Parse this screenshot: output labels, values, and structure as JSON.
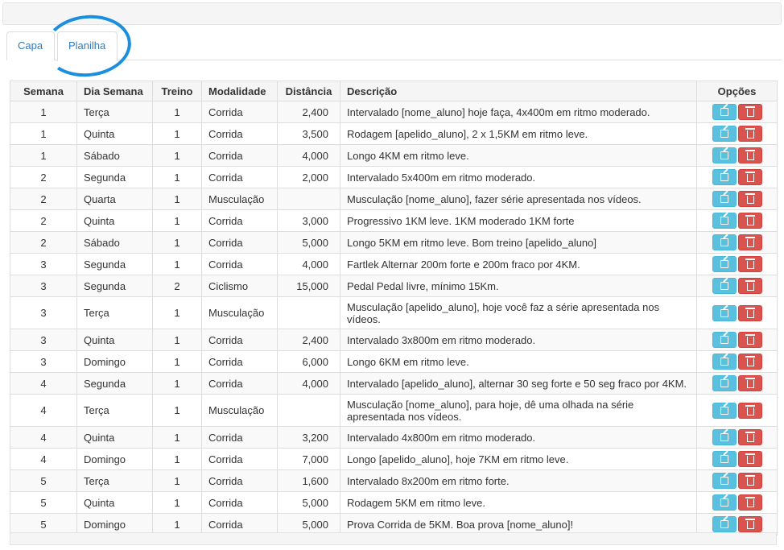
{
  "tabs": [
    {
      "label": "Capa"
    },
    {
      "label": "Planilha"
    }
  ],
  "table": {
    "headers": {
      "semana": "Semana",
      "dia": "Dia Semana",
      "treino": "Treino",
      "modalidade": "Modalidade",
      "distancia": "Distância",
      "descricao": "Descrição",
      "opcoes": "Opções"
    },
    "rows": [
      {
        "semana": "1",
        "dia": "Terça",
        "treino": "1",
        "modalidade": "Corrida",
        "distancia": "2,400",
        "descricao": "Intervalado [nome_aluno] hoje faça, 4x400m em ritmo moderado."
      },
      {
        "semana": "1",
        "dia": "Quinta",
        "treino": "1",
        "modalidade": "Corrida",
        "distancia": "3,500",
        "descricao": "Rodagem [apelido_aluno], 2 x 1,5KM em ritmo leve."
      },
      {
        "semana": "1",
        "dia": "Sábado",
        "treino": "1",
        "modalidade": "Corrida",
        "distancia": "4,000",
        "descricao": "Longo 4KM em ritmo leve."
      },
      {
        "semana": "2",
        "dia": "Segunda",
        "treino": "1",
        "modalidade": "Corrida",
        "distancia": "2,000",
        "descricao": "Intervalado 5x400m em ritmo moderado."
      },
      {
        "semana": "2",
        "dia": "Quarta",
        "treino": "1",
        "modalidade": "Musculação",
        "distancia": "",
        "descricao": "Musculação [nome_aluno], fazer série apresentada nos vídeos."
      },
      {
        "semana": "2",
        "dia": "Quinta",
        "treino": "1",
        "modalidade": "Corrida",
        "distancia": "3,000",
        "descricao": "Progressivo 1KM leve. 1KM moderado 1KM forte"
      },
      {
        "semana": "2",
        "dia": "Sábado",
        "treino": "1",
        "modalidade": "Corrida",
        "distancia": "5,000",
        "descricao": "Longo 5KM em ritmo leve. Bom treino [apelido_aluno]"
      },
      {
        "semana": "3",
        "dia": "Segunda",
        "treino": "1",
        "modalidade": "Corrida",
        "distancia": "4,000",
        "descricao": "Fartlek Alternar 200m forte e 200m fraco por 4KM."
      },
      {
        "semana": "3",
        "dia": "Segunda",
        "treino": "2",
        "modalidade": "Ciclismo",
        "distancia": "15,000",
        "descricao": "Pedal Pedal livre, mínimo 15Km."
      },
      {
        "semana": "3",
        "dia": "Terça",
        "treino": "1",
        "modalidade": "Musculação",
        "distancia": "",
        "descricao": "Musculação [apelido_aluno], hoje você faz a série apresentada nos vídeos."
      },
      {
        "semana": "3",
        "dia": "Quinta",
        "treino": "1",
        "modalidade": "Corrida",
        "distancia": "2,400",
        "descricao": "Intervalado 3x800m em ritmo moderado."
      },
      {
        "semana": "3",
        "dia": "Domingo",
        "treino": "1",
        "modalidade": "Corrida",
        "distancia": "6,000",
        "descricao": "Longo 6KM em ritmo leve."
      },
      {
        "semana": "4",
        "dia": "Segunda",
        "treino": "1",
        "modalidade": "Corrida",
        "distancia": "4,000",
        "descricao": "Intervalado [apelido_aluno], alternar 30 seg forte e 50 seg fraco por 4KM."
      },
      {
        "semana": "4",
        "dia": "Terça",
        "treino": "1",
        "modalidade": "Musculação",
        "distancia": "",
        "descricao": "Musculação [nome_aluno], para hoje, dê uma olhada na série apresentada nos vídeos."
      },
      {
        "semana": "4",
        "dia": "Quinta",
        "treino": "1",
        "modalidade": "Corrida",
        "distancia": "3,200",
        "descricao": "Intervalado 4x800m em ritmo moderado."
      },
      {
        "semana": "4",
        "dia": "Domingo",
        "treino": "1",
        "modalidade": "Corrida",
        "distancia": "7,000",
        "descricao": "Longo [apelido_aluno], hoje 7KM em ritmo leve."
      },
      {
        "semana": "5",
        "dia": "Terça",
        "treino": "1",
        "modalidade": "Corrida",
        "distancia": "1,600",
        "descricao": "Intervalado 8x200m em ritmo forte."
      },
      {
        "semana": "5",
        "dia": "Quinta",
        "treino": "1",
        "modalidade": "Corrida",
        "distancia": "5,000",
        "descricao": "Rodagem 5KM em ritmo leve."
      },
      {
        "semana": "5",
        "dia": "Domingo",
        "treino": "1",
        "modalidade": "Corrida",
        "distancia": "5,000",
        "descricao": "Prova Corrida de 5KM. Boa prova [nome_aluno]!"
      }
    ]
  },
  "icons": {
    "edit": "edit-icon",
    "delete": "trash-icon"
  },
  "colors": {
    "edit_button": "#5bc0de",
    "delete_button": "#d9534f",
    "link": "#337ab7",
    "highlight_circle": "#1a8fe0"
  }
}
